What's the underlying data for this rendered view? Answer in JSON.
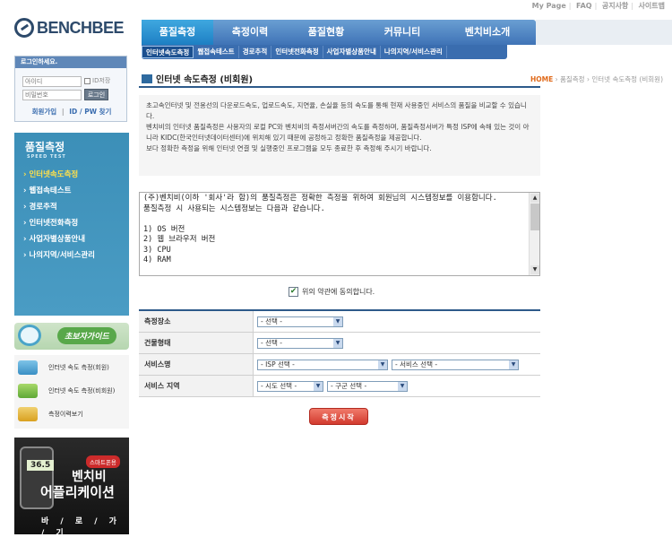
{
  "top_links": [
    "My Page",
    "FAQ",
    "공지사항",
    "사이트맵"
  ],
  "logo": {
    "text": "BENCHBEE"
  },
  "nav": {
    "main": [
      "품질측정",
      "측정이력",
      "품질현황",
      "커뮤니티",
      "벤치비소개"
    ],
    "sub": [
      "인터넷속도측정",
      "웹접속테스트",
      "경로추적",
      "인터넷전화측정",
      "사업자별상품안내",
      "나의지역/서비스관리"
    ]
  },
  "login": {
    "title": "로그인하세요.",
    "id_placeholder": "아이디",
    "pw_placeholder": "비밀번호",
    "save_id": "ID저장",
    "login_button": "로그인",
    "join": "회원가입",
    "find": "ID / PW 찾기",
    "link_separator": "|"
  },
  "sidemenu": {
    "title": "품질측정",
    "subtitle": "SPEED TEST",
    "items": [
      "인터넷속도측정",
      "웹접속테스트",
      "경로추적",
      "인터넷전화측정",
      "사업자별상품안내",
      "나의지역/서비스관리"
    ]
  },
  "guide": {
    "label": "초보자가이드"
  },
  "quick_links": [
    "인터넷 속도 측정(회원)",
    "인터넷 속도 측정(비회원)",
    "측정이력보기"
  ],
  "app_banner": {
    "reading": "36.5",
    "badge": "스마트폰용",
    "line1": "벤치비",
    "line2": "어플리케이션",
    "line3": "바 / 로 / 가 / 기"
  },
  "content": {
    "title": "인터넷 속도측정 (비회원)",
    "breadcrumb": {
      "home": "HOME",
      "level1": "품질측정",
      "level2": "인터넷 속도측정 (비회원)"
    },
    "intro": [
      "초고속인터넷 및 전용선의 다운로드속도, 업로드속도, 지연율, 손실율 등의 속도를 통해 현재 사용중인 서비스의 품질을 비교할 수 있습니다.",
      "벤치비의 인터넷 품질측정은 사용자의 로컬 PC와 벤치비의 측정서버간의 속도를 측정하며, 품질측정서버가 특정 ISP에 속해 있는 것이 아니라 KIDC(한국인터넷데이터센터)에 위치해 있기 때문에 공정하고 정확한 품질측정을 제공합니다.",
      "보다 정확한 측정을 위해 인터넷 연결 및 실행중인 프로그램을 모두 종료한 후 측정해 주시기 바랍니다."
    ],
    "terms": "(주)벤치비(이하 '회사'라 함)의 품질측정은 정확한 측정을 위하여 회원님의 시스템정보를 이용합니다.\n품질측정 시 사용되는 시스템정보는 다음과 같습니다.\n\n1) OS 버전\n2) 웹 브라우저 버전\n3) CPU\n4) RAM",
    "agree_label": "위의 약관에 동의합니다.",
    "form": [
      {
        "label": "측정장소",
        "selects": [
          "- 선택 -"
        ]
      },
      {
        "label": "건물형태",
        "selects": [
          "- 선택 -"
        ]
      },
      {
        "label": "서비스명",
        "selects": [
          "- ISP 선택 -",
          "- 서비스 선택 -"
        ]
      },
      {
        "label": "서비스 지역",
        "selects": [
          "- 시도 선택 -",
          "- 구군 선택 -"
        ]
      }
    ],
    "start_button": "측정시작"
  }
}
